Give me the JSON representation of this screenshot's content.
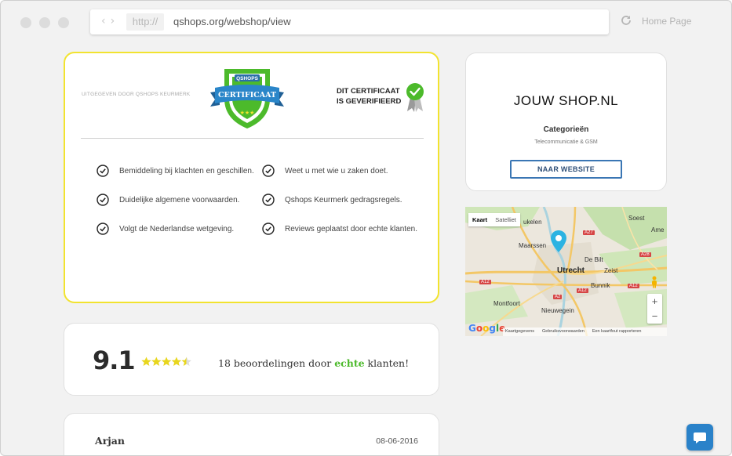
{
  "browser": {
    "scheme": "http://",
    "url": "qshops.org/webshop/view",
    "home_label": "Home Page"
  },
  "certificate": {
    "issued_by": "UITGEGEVEN DOOR QSHOPS KEURMERK",
    "badge_brand": "QSHOPS",
    "badge_label": "CERTIFICAAT",
    "verified_line1": "DIT CERTIFICAAT",
    "verified_line2": "IS GEVERIFIEERD",
    "features": [
      "Bemiddeling bij klachten en geschillen.",
      "Weet u met wie u zaken doet.",
      "Duidelijke algemene voorwaarden.",
      "Qshops Keurmerk gedragsregels.",
      "Volgt de Nederlandse wetgeving.",
      "Reviews geplaatst door echte klanten."
    ]
  },
  "rating": {
    "score": "9.1",
    "stars": 4.5,
    "text_before": "18 beoordelingen door ",
    "text_highlight": "echte",
    "text_after": " klanten!"
  },
  "review": {
    "name": "Arjan",
    "date": "08-06-2016"
  },
  "shop": {
    "name": "JOUW  SHOP.NL",
    "category_title": "Categorieën",
    "category_value": "Telecommunicatie & GSM",
    "button_label": "NAAR WEBSITE"
  },
  "map": {
    "tab_map": "Kaart",
    "tab_satellite": "Satelliet",
    "labels": {
      "soest": "Soest",
      "amersfoort": "Ame",
      "maarssen": "Maarssen",
      "utrecht": "Utrecht",
      "zeist": "Zeist",
      "debilt": "De Bilt",
      "bunnik": "Bunnik",
      "montfoort": "Montfoort",
      "nieuwegein": "Nieuwegein",
      "breukelen": "ukelen"
    },
    "shields": [
      "A27",
      "A28",
      "A12",
      "A12",
      "A12",
      "A2"
    ],
    "zoom_in": "+",
    "zoom_out": "−",
    "logo": "Google",
    "footer": [
      "Kaartgegevens",
      "Gebruiksvoorwaarden",
      "Een kaartfout rapporteren"
    ]
  },
  "colors": {
    "accent_yellow": "#f2e32f",
    "accent_green": "#4cba2b",
    "accent_blue": "#3a76b4",
    "chat_blue": "#2a82c9"
  }
}
